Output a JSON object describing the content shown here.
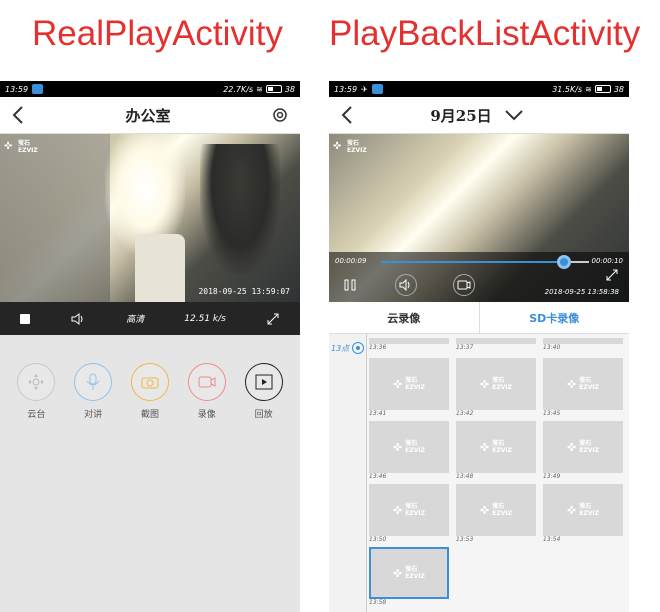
{
  "captions": {
    "left": "RealPlayActivity",
    "right": "PlayBackListActivity"
  },
  "realplay": {
    "status": {
      "time": "13:59",
      "speed": "22.7K/s",
      "battery": "38"
    },
    "title": "办公室",
    "stamp": "2018-09-25 13:59:07",
    "logo_cn": "萤石",
    "logo_en": "EZVIZ",
    "controls": {
      "quality": "高清",
      "rate": "12.51 k/s"
    },
    "actions": [
      {
        "label": "云台",
        "color": "#c8c8c8"
      },
      {
        "label": "对讲",
        "color": "#8fc3ee"
      },
      {
        "label": "截图",
        "color": "#f0b84a"
      },
      {
        "label": "录像",
        "color": "#f08a8a"
      },
      {
        "label": "回放",
        "color": "#222222"
      }
    ]
  },
  "playback": {
    "status": {
      "time": "13:59",
      "speed": "31.5K/s",
      "battery": "38"
    },
    "date": "9月25日",
    "stamp": "2018-09-25 13:58:38",
    "time_start": "00:00:09",
    "time_end": "00:00:10",
    "progress": 0.88,
    "tabs": [
      "云录像",
      "SD卡录像"
    ],
    "hour": "13点",
    "top_times": [
      "13:36",
      "13:37",
      "13:40"
    ],
    "clips": [
      {
        "time": "13:41"
      },
      {
        "time": "13:42"
      },
      {
        "time": "13:45"
      },
      {
        "time": "13:46"
      },
      {
        "time": "13:48"
      },
      {
        "time": "13:49"
      },
      {
        "time": "13:50"
      },
      {
        "time": "13:53"
      },
      {
        "time": "13:54"
      },
      {
        "time": "13:58",
        "selected": true
      }
    ]
  }
}
